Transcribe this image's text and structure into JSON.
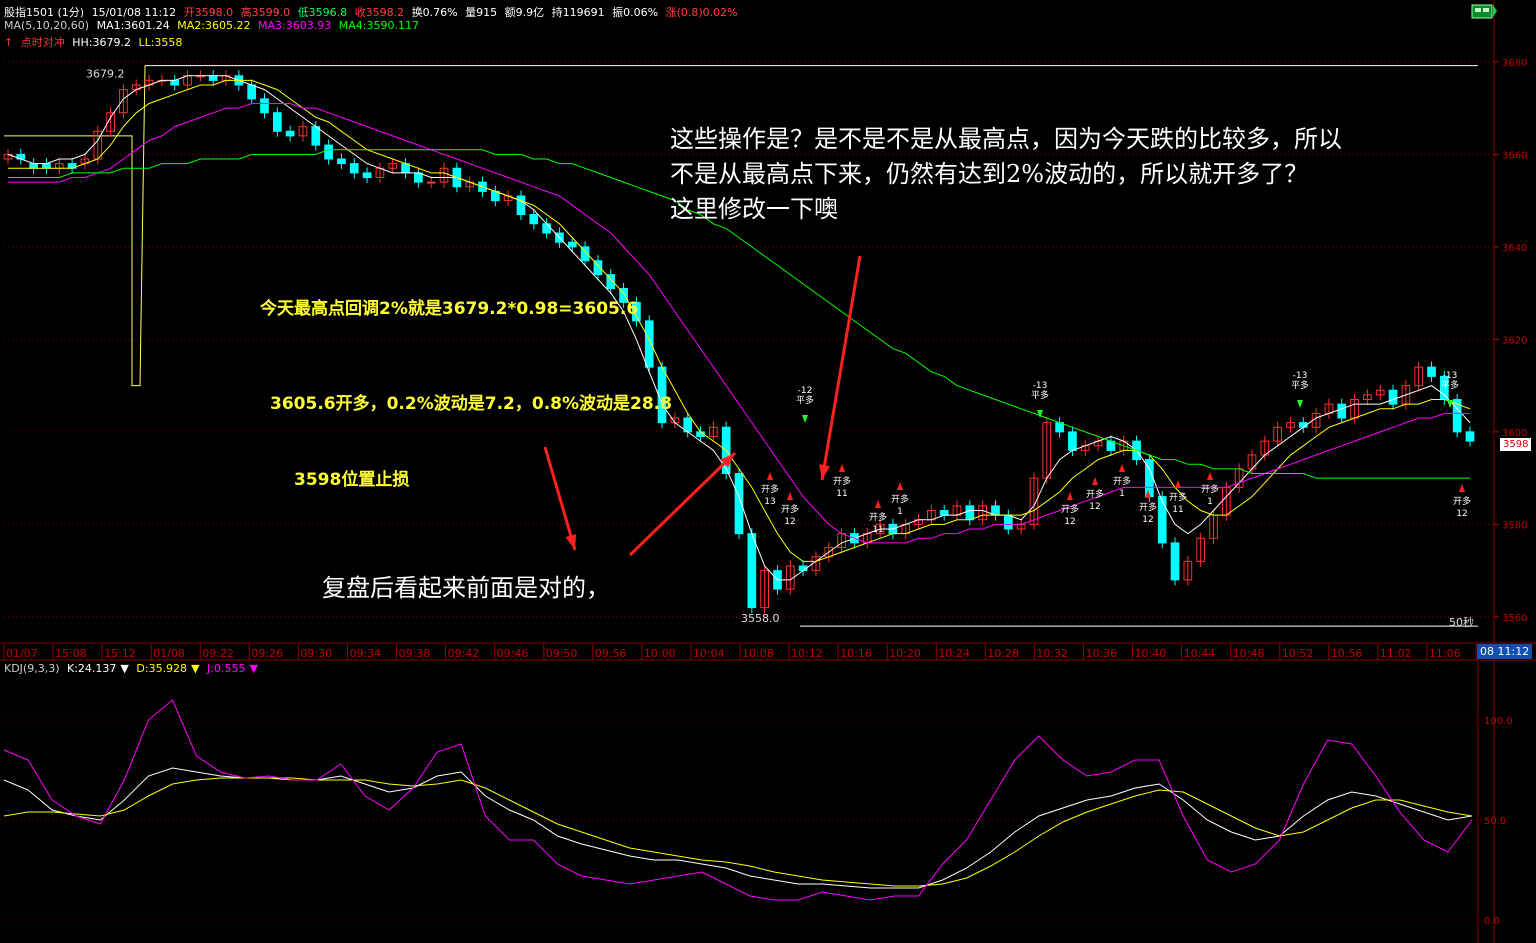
{
  "header": {
    "symbol": "股指1501 (1分)",
    "date": "15/01/08 11:12",
    "open": "开3598.0",
    "high": "高3599.0",
    "low": "低3596.8",
    "close": "收3598.2",
    "turnover": "换0.76%",
    "volume": "量915",
    "amount": "额9.9亿",
    "position": "持119691",
    "amplitude": "振0.06%",
    "change": "涨(0.8)0.02%"
  },
  "ma_line": {
    "label": "MA(5,10,20,60)",
    "ma1": "MA1:3601.24",
    "ma2": "MA2:3605.22",
    "ma3": "MA3:3603.93",
    "ma4": "MA4:3590.117"
  },
  "signal_line": {
    "label": "点时对冲",
    "hh": "HH:3679.2",
    "ll": "LL:3558"
  },
  "kdj_line": {
    "label": "KDJ(9,3,3)",
    "k": "K:24.137",
    "d": "D:35.928",
    "j": "J:0.555"
  },
  "badges": {
    "last_price": "3598",
    "time": "08 11:12",
    "interval": "50秒"
  },
  "annotations": {
    "question_lines": [
      "这些操作是？是不是不是从最高点，因为今天跌的比较多，所以",
      "不是从最高点下来，仍然有达到2%波动的，所以就开多了？",
      "这里修改一下噢"
    ],
    "calc": "今天最高点回调2%就是3679.2*0.98=3605.6",
    "open_long": "3605.6开多，0.2%波动是7.2，0.8%波动是28.8",
    "stop_loss": "3598位置止损",
    "review": "复盘后看起来前面是对的，"
  },
  "colors": {
    "up": "#ff3030",
    "down": "#00ffff",
    "ma1": "#ffffff",
    "ma2": "#ffff00",
    "ma3": "#ff00ff",
    "ma4": "#00ff00",
    "grid": "#8b0000",
    "axis_text": "#c00000"
  },
  "chart_data": [
    {
      "type": "candlestick",
      "title": "",
      "price_ticks": [
        "3680",
        "3660",
        "3640",
        "3620",
        "3600",
        "3580",
        "3560"
      ],
      "ylim": [
        3555,
        3683
      ],
      "time_ticks": [
        "01/07",
        "15:08",
        "15:12",
        "01/08",
        "09:22",
        "09:26",
        "09:30",
        "09:34",
        "09:38",
        "09:42",
        "09:46",
        "09:50",
        "09:56",
        "10:00",
        "10:04",
        "10:08",
        "10:12",
        "10:16",
        "10:20",
        "10:24",
        "10:28",
        "10:32",
        "10:36",
        "10:40",
        "10:44",
        "10:48",
        "10:52",
        "10:56",
        "11:02",
        "11:06",
        "11:1"
      ],
      "hh_label": "3679.2",
      "ll_label": "3558.0",
      "series": [
        {
          "name": "MA1",
          "values": [
            3660,
            3659,
            3658,
            3658,
            3659,
            3659,
            3660,
            3663,
            3668,
            3672,
            3674,
            3675,
            3676,
            3676,
            3677,
            3677,
            3677,
            3677,
            3676,
            3675,
            3674,
            3672,
            3670,
            3668,
            3666,
            3664,
            3662,
            3660,
            3658,
            3657,
            3656,
            3656,
            3656,
            3655,
            3655,
            3655,
            3654,
            3653,
            3652,
            3651,
            3650,
            3648,
            3645,
            3642,
            3639,
            3636,
            3633,
            3630,
            3626,
            3620,
            3613,
            3606,
            3602,
            3600,
            3598,
            3596,
            3592,
            3586,
            3578,
            3571,
            3568,
            3568,
            3570,
            3572,
            3574,
            3576,
            3577,
            3578,
            3579,
            3579,
            3580,
            3581,
            3581,
            3582,
            3582,
            3583,
            3583,
            3582,
            3582,
            3581,
            3584,
            3590,
            3594,
            3596,
            3597,
            3598,
            3599,
            3598,
            3596,
            3592,
            3585,
            3580,
            3578,
            3580,
            3583,
            3586,
            3589,
            3592,
            3595,
            3597,
            3599,
            3601,
            3603,
            3604,
            3605,
            3606,
            3606,
            3606,
            3607,
            3608,
            3609,
            3610,
            3608,
            3605,
            3602
          ]
        },
        {
          "name": "MA2",
          "values": [
            3657,
            3657,
            3657,
            3657,
            3657,
            3657,
            3658,
            3659,
            3662,
            3666,
            3669,
            3671,
            3672,
            3673,
            3674,
            3675,
            3675,
            3676,
            3676,
            3676,
            3675,
            3674,
            3672,
            3670,
            3668,
            3667,
            3665,
            3663,
            3661,
            3660,
            3659,
            3658,
            3657,
            3656,
            3656,
            3655,
            3654,
            3653,
            3652,
            3651,
            3650,
            3649,
            3647,
            3645,
            3642,
            3639,
            3636,
            3633,
            3630,
            3625,
            3620,
            3614,
            3609,
            3604,
            3600,
            3598,
            3596,
            3592,
            3588,
            3583,
            3578,
            3574,
            3572,
            3572,
            3573,
            3574,
            3575,
            3576,
            3577,
            3578,
            3578,
            3579,
            3580,
            3580,
            3581,
            3581,
            3582,
            3582,
            3582,
            3582,
            3583,
            3585,
            3587,
            3590,
            3592,
            3594,
            3595,
            3596,
            3596,
            3595,
            3592,
            3588,
            3585,
            3583,
            3582,
            3582,
            3584,
            3586,
            3589,
            3592,
            3595,
            3597,
            3599,
            3601,
            3602,
            3603,
            3604,
            3605,
            3605,
            3606,
            3606,
            3607,
            3607,
            3606,
            3605
          ]
        },
        {
          "name": "MA3",
          "values": [
            3654,
            3654,
            3654,
            3654,
            3654,
            3655,
            3655,
            3656,
            3657,
            3659,
            3661,
            3663,
            3664,
            3666,
            3667,
            3668,
            3669,
            3670,
            3670,
            3671,
            3671,
            3671,
            3671,
            3670,
            3670,
            3669,
            3668,
            3667,
            3666,
            3665,
            3664,
            3663,
            3662,
            3661,
            3660,
            3659,
            3658,
            3657,
            3656,
            3655,
            3654,
            3653,
            3652,
            3651,
            3649,
            3647,
            3645,
            3643,
            3640,
            3637,
            3634,
            3630,
            3626,
            3622,
            3618,
            3614,
            3610,
            3606,
            3602,
            3598,
            3594,
            3590,
            3586,
            3583,
            3580,
            3578,
            3577,
            3576,
            3576,
            3576,
            3576,
            3577,
            3577,
            3578,
            3578,
            3579,
            3579,
            3580,
            3580,
            3580,
            3581,
            3582,
            3583,
            3584,
            3585,
            3586,
            3587,
            3588,
            3588,
            3588,
            3588,
            3588,
            3588,
            3588,
            3588,
            3588,
            3589,
            3590,
            3591,
            3592,
            3593,
            3594,
            3595,
            3596,
            3597,
            3598,
            3599,
            3600,
            3601,
            3602,
            3603,
            3603,
            3604,
            3604,
            3604
          ]
        },
        {
          "name": "MA4",
          "values": [
            3655,
            3655,
            3655,
            3655,
            3655,
            3656,
            3656,
            3656,
            3656,
            3657,
            3657,
            3657,
            3658,
            3658,
            3658,
            3659,
            3659,
            3659,
            3659,
            3660,
            3660,
            3660,
            3660,
            3660,
            3660,
            3661,
            3661,
            3661,
            3661,
            3661,
            3661,
            3661,
            3661,
            3661,
            3661,
            3661,
            3661,
            3661,
            3660,
            3660,
            3660,
            3659,
            3659,
            3658,
            3658,
            3657,
            3656,
            3655,
            3654,
            3653,
            3652,
            3651,
            3650,
            3648,
            3647,
            3645,
            3644,
            3642,
            3640,
            3638,
            3636,
            3634,
            3632,
            3630,
            3628,
            3626,
            3624,
            3622,
            3620,
            3618,
            3617,
            3615,
            3613,
            3612,
            3610,
            3609,
            3608,
            3607,
            3606,
            3605,
            3604,
            3603,
            3602,
            3601,
            3600,
            3599,
            3598,
            3597,
            3596,
            3595,
            3594,
            3594,
            3593,
            3593,
            3592,
            3592,
            3592,
            3591,
            3591,
            3591,
            3591,
            3591,
            3590,
            3590,
            3590,
            3590,
            3590,
            3590,
            3590,
            3590,
            3590,
            3590,
            3590,
            3590,
            3590
          ]
        }
      ],
      "closes": [
        3660,
        3659,
        3657,
        3657,
        3658,
        3657,
        3659,
        3665,
        3669,
        3674,
        3675,
        3676,
        3676,
        3675,
        3677,
        3677,
        3676,
        3677,
        3675,
        3672,
        3669,
        3665,
        3664,
        3666,
        3662,
        3659,
        3658,
        3656,
        3655,
        3657,
        3658,
        3656,
        3654,
        3654,
        3657,
        3653,
        3654,
        3652,
        3650,
        3651,
        3647,
        3645,
        3643,
        3641,
        3640,
        3637,
        3634,
        3631,
        3628,
        3624,
        3614,
        3602,
        3603,
        3600,
        3599,
        3601,
        3591,
        3578,
        3562,
        3570,
        3566,
        3571,
        3570,
        3573,
        3575,
        3578,
        3576,
        3578,
        3580,
        3578,
        3580,
        3581,
        3583,
        3582,
        3584,
        3581,
        3584,
        3582,
        3579,
        3580,
        3590,
        3602,
        3600,
        3596,
        3597,
        3598,
        3596,
        3598,
        3594,
        3586,
        3576,
        3568,
        3572,
        3577,
        3582,
        3588,
        3592,
        3595,
        3598,
        3601,
        3602,
        3601,
        3604,
        3606,
        3603,
        3607,
        3608,
        3609,
        3606,
        3610,
        3614,
        3612,
        3607,
        3600,
        3598
      ],
      "opens": [
        3659,
        3660,
        3658,
        3658,
        3657,
        3658,
        3658,
        3659,
        3665,
        3669,
        3674,
        3675,
        3676,
        3676,
        3675,
        3677,
        3677,
        3676,
        3677,
        3675,
        3672,
        3669,
        3665,
        3664,
        3666,
        3662,
        3659,
        3658,
        3656,
        3655,
        3657,
        3658,
        3656,
        3654,
        3654,
        3657,
        3653,
        3654,
        3652,
        3650,
        3651,
        3647,
        3645,
        3643,
        3641,
        3640,
        3637,
        3634,
        3631,
        3628,
        3624,
        3614,
        3602,
        3603,
        3600,
        3599,
        3601,
        3591,
        3578,
        3562,
        3570,
        3566,
        3571,
        3570,
        3573,
        3575,
        3578,
        3576,
        3578,
        3580,
        3578,
        3580,
        3581,
        3583,
        3582,
        3584,
        3581,
        3584,
        3582,
        3579,
        3580,
        3590,
        3602,
        3600,
        3596,
        3597,
        3598,
        3596,
        3598,
        3594,
        3586,
        3576,
        3568,
        3572,
        3577,
        3582,
        3588,
        3592,
        3595,
        3598,
        3601,
        3602,
        3601,
        3604,
        3606,
        3603,
        3607,
        3608,
        3609,
        3606,
        3610,
        3614,
        3612,
        3607,
        3600
      ]
    },
    {
      "type": "line",
      "title": "KDJ(9,3,3)",
      "ylim": [
        -10,
        120
      ],
      "ticks": [
        "100.0",
        "50.0",
        "0.0"
      ],
      "series": [
        {
          "name": "K",
          "values": [
            70,
            65,
            55,
            52,
            50,
            60,
            72,
            76,
            74,
            72,
            71,
            71,
            70,
            70,
            72,
            68,
            64,
            66,
            72,
            74,
            62,
            55,
            50,
            42,
            38,
            35,
            32,
            30,
            30,
            28,
            26,
            22,
            20,
            18,
            18,
            17,
            16,
            16,
            16,
            20,
            26,
            34,
            44,
            52,
            56,
            60,
            62,
            66,
            68,
            60,
            50,
            44,
            40,
            42,
            52,
            60,
            64,
            62,
            58,
            54,
            50,
            52
          ]
        },
        {
          "name": "D",
          "values": [
            52,
            54,
            54,
            53,
            52,
            55,
            62,
            68,
            70,
            71,
            71,
            71,
            71,
            70,
            70,
            70,
            68,
            67,
            68,
            70,
            66,
            60,
            54,
            48,
            44,
            40,
            36,
            34,
            32,
            30,
            29,
            27,
            24,
            22,
            20,
            19,
            18,
            17,
            17,
            18,
            21,
            27,
            34,
            42,
            49,
            54,
            58,
            62,
            65,
            64,
            58,
            52,
            46,
            42,
            44,
            50,
            56,
            60,
            60,
            57,
            54,
            52
          ]
        },
        {
          "name": "J",
          "values": [
            85,
            80,
            60,
            52,
            48,
            70,
            100,
            110,
            82,
            74,
            71,
            72,
            70,
            70,
            78,
            62,
            55,
            66,
            84,
            88,
            52,
            40,
            40,
            28,
            22,
            20,
            18,
            20,
            22,
            24,
            18,
            12,
            10,
            10,
            14,
            12,
            10,
            12,
            12,
            28,
            40,
            60,
            80,
            92,
            80,
            72,
            74,
            80,
            80,
            52,
            30,
            24,
            28,
            40,
            68,
            90,
            88,
            72,
            54,
            40,
            34,
            50
          ]
        }
      ]
    }
  ]
}
